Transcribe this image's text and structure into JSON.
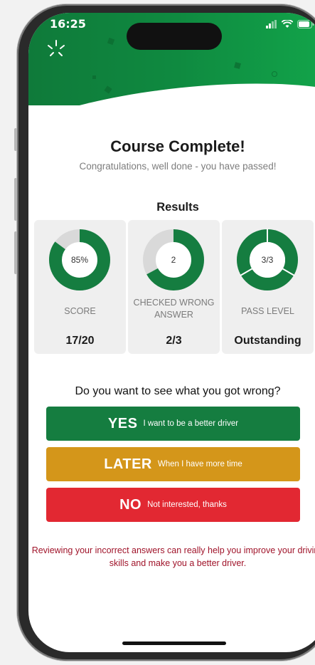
{
  "status": {
    "time": "16:25"
  },
  "header": {
    "title": "Course Complete!",
    "subtitle": "Congratulations, well done - you have passed!"
  },
  "results": {
    "title": "Results",
    "cards": [
      {
        "center": "85%",
        "label": "SCORE",
        "value": "17/20",
        "fraction": 0.85
      },
      {
        "center": "2",
        "label": "CHECKED WRONG ANSWER",
        "value": "2/3",
        "fraction": 0.67
      },
      {
        "center": "3/3",
        "label": "PASS LEVEL",
        "value": "Outstanding",
        "fraction": 1.0
      }
    ]
  },
  "question": "Do you want to see what you got wrong?",
  "actions": {
    "yes": {
      "big": "YES",
      "small": "I want to be a better driver"
    },
    "later": {
      "big": "LATER",
      "small": "When I have more time"
    },
    "no": {
      "big": "NO",
      "small": "Not interested, thanks"
    }
  },
  "footnote": "Reviewing your incorrect answers can really help you improve your driving skills and make you a better driver.",
  "colors": {
    "green": "#157d40",
    "amber": "#d4961a",
    "red": "#e22832",
    "ring_bg": "#d9d9d9"
  },
  "icons": {
    "status": [
      "signal-icon",
      "wifi-icon",
      "battery-icon"
    ],
    "decor": "sparkle-icon"
  }
}
